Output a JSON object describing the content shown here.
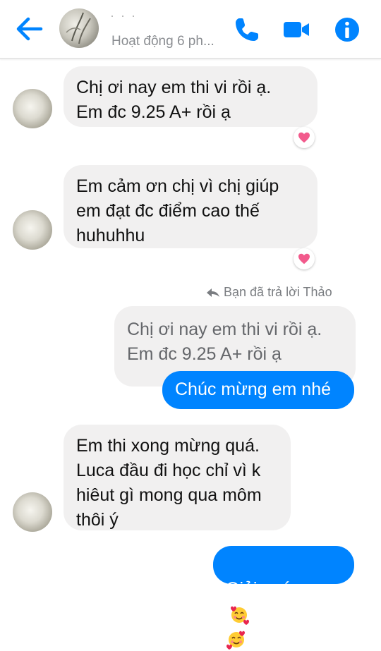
{
  "header": {
    "contact_name": "· · ·",
    "status": "Hoạt động 6 ph...",
    "icons": [
      "back-arrow-icon",
      "phone-icon",
      "video-camera-icon",
      "info-icon"
    ],
    "accent_color": "#0084ff"
  },
  "messages": [
    {
      "from": "them",
      "text": "Chị ơi nay em thi vi rồi ạ.\nEm đc 9.25 A+ rồi ạ",
      "reaction": "heart"
    },
    {
      "from": "them",
      "text": "Em cảm ơn chị vì chị giúp\nem đạt đc điểm cao thế\nhuhuhhu",
      "reaction": "heart"
    },
    {
      "from": "me",
      "reply_note": "Bạn đã trả lời Thảo",
      "quoted_text": "Chị ơi nay em thi vi rồi ạ.\nEm đc 9.25 A+ rồi ạ",
      "text": "Chúc mừng em nhé"
    },
    {
      "from": "them",
      "text": "Em thi xong mừng quá.\nLuca đầu đi học chỉ vì k\nhiêut gì mong qua môm\nthôi ý"
    },
    {
      "from": "me",
      "text": "Giỏi quá",
      "emoji": [
        "smiling-face-with-hearts",
        "smiling-face-with-hearts"
      ]
    }
  ]
}
